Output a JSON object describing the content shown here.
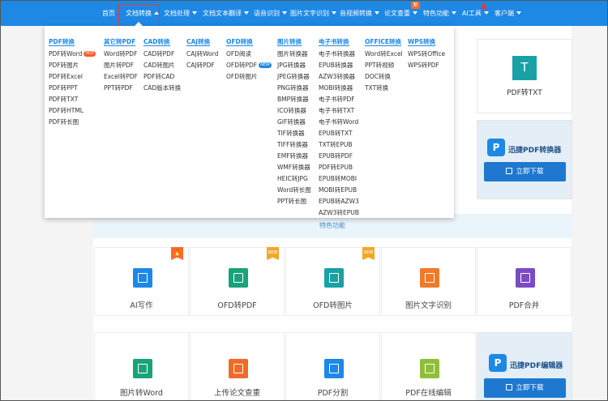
{
  "nav": {
    "items": [
      {
        "label": "首页"
      },
      {
        "label": "文档转换"
      },
      {
        "label": "文档处理"
      },
      {
        "label": "文档文本翻译"
      },
      {
        "label": "语音识别"
      },
      {
        "label": "图片文字识别"
      },
      {
        "label": "音视频转换"
      },
      {
        "label": "论文查重"
      },
      {
        "label": "特色功能"
      },
      {
        "label": "AI工具"
      },
      {
        "label": "客户端"
      }
    ],
    "new_badge": "新"
  },
  "menu": {
    "columns": [
      {
        "header": "PDF转换",
        "items": [
          "PDF转Word",
          "PDF转图片",
          "PDF转Excel",
          "PDF转PPT",
          "PDF转TXT",
          "PDF转HTML",
          "PDF转长图"
        ]
      },
      {
        "header": "其它转PDF",
        "items": [
          "Word转PDF",
          "图片转PDF",
          "Excel转PDF",
          "PPT转PDF"
        ]
      },
      {
        "header": "CAD转换",
        "items": [
          "CAD转PDF",
          "CAD转图片",
          "PDF转CAD",
          "CAD版本转换"
        ]
      },
      {
        "header": "CAJ转换",
        "items": [
          "CAJ转Word",
          "CAJ转PDF"
        ]
      },
      {
        "header": "OFD转换",
        "items": [
          "OFD阅读",
          "OFD转PDF",
          "OFD转图片"
        ]
      },
      {
        "header": "图片转换",
        "items": [
          "图片转换器",
          "JPG转换器",
          "JPEG转换器",
          "PNG转换器",
          "BMP转换器",
          "ICO转换器",
          "GIF转换器",
          "TIF转换器",
          "TIFF转换器",
          "EMF转换器",
          "WMF转换器",
          "HEIC转JPG",
          "Word转长图",
          "PPT转长图"
        ]
      },
      {
        "header": "电子书转换",
        "items": [
          "电子书转换器",
          "EPUB转换器",
          "AZW3转换器",
          "MOBI转换器",
          "电子书转PDF",
          "电子书转TXT",
          "电子书转Word",
          "EPUB转TXT",
          "TXT转EPUB",
          "EPUB转PDF",
          "PDF转EPUB",
          "EPUB转MOBI",
          "MOBI转EPUB",
          "EPUB转AZW3",
          "AZW3转EPUB"
        ]
      },
      {
        "header": "OFFICE转换",
        "items": [
          "Word转Excel",
          "PPT转视频",
          "DOC转换",
          "TXT转换"
        ]
      },
      {
        "header": "WPS转换",
        "items": [
          "WPS转Office",
          "WPS转PDF"
        ]
      }
    ],
    "badges": {
      "hot": "HOT",
      "new": "NEW"
    }
  },
  "page": {
    "pdf_txt_label": "PDF转TXT",
    "t_icon": "T",
    "promo1_title": "迅捷PDF转换器",
    "promo2_title": "迅捷PDF编辑器",
    "download_label": "立即下载",
    "feature_bar": "特色功能",
    "row1": [
      {
        "label": "AI写作",
        "color": "#1e88e5",
        "tag": "hot"
      },
      {
        "label": "OFD转PDF",
        "color": "#1aa37a",
        "tag": "new"
      },
      {
        "label": "OFD转图片",
        "color": "#1aa1a5",
        "tag": "new"
      },
      {
        "label": "图片文字识别",
        "color": "#f07a2a",
        "tag": ""
      },
      {
        "label": "PDF合并",
        "color": "#7b4bc4",
        "tag": ""
      }
    ],
    "row2": [
      {
        "label": "图片转Word",
        "color": "#1aa37a"
      },
      {
        "label": "上传论文查重",
        "color": "#f06a2a"
      },
      {
        "label": "PDF分割",
        "color": "#1e88e5"
      },
      {
        "label": "PDF在线编辑",
        "color": "#8fbf3a"
      }
    ],
    "tag_labels": {
      "hot": "🔥",
      "new": "NEW"
    }
  }
}
